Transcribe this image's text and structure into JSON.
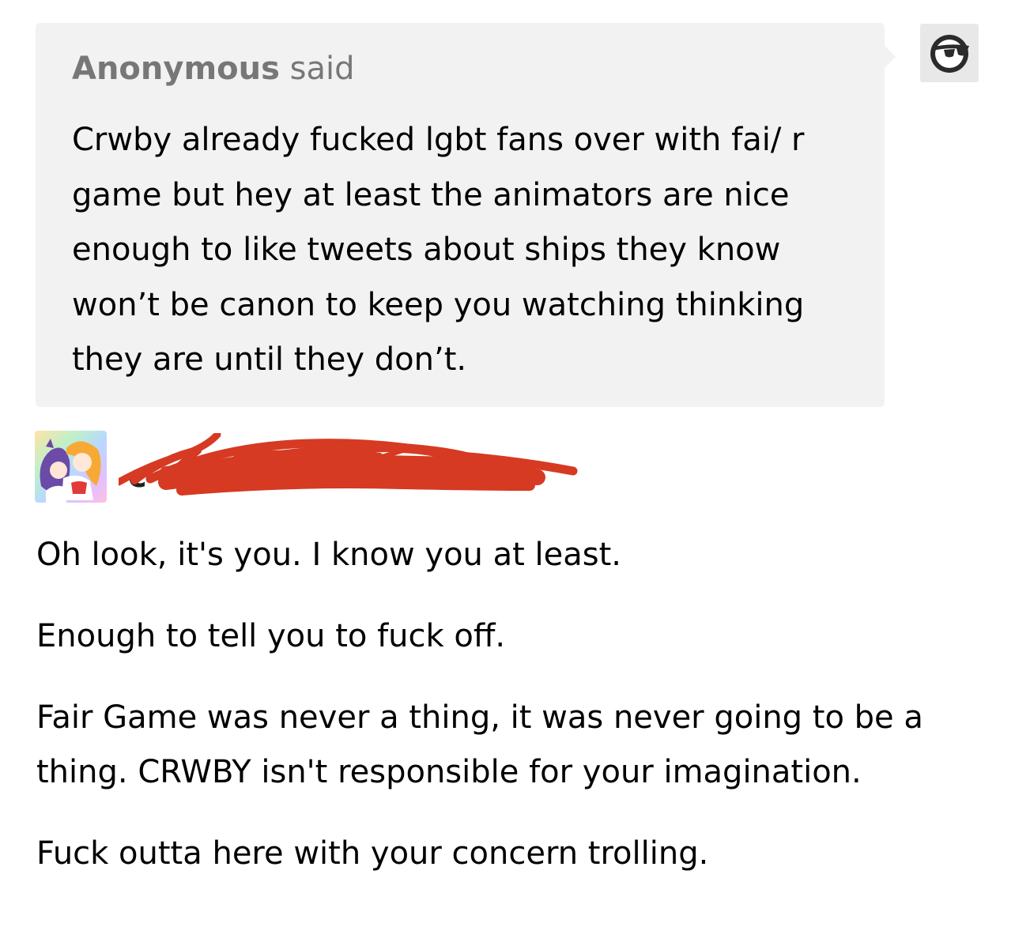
{
  "ask": {
    "asker_name": "Anonymous",
    "asker_suffix": "said",
    "question": "Crwby already fucked lgbt fans over with fai/ r game but hey at least the animators are nice enough to like tweets about ships they know won’t be canon to keep you watching thinking they are until they don’t."
  },
  "icons": {
    "anon_avatar": "sunglasses-ghost-icon",
    "user_avatar": "anime-couple-rainbow-avatar"
  },
  "responder": {
    "username_visible": "c",
    "redaction_color": "#d63a22"
  },
  "answer": {
    "paragraphs": [
      "Oh look, it's you. I know you at least.",
      "Enough to tell you to fuck off.",
      "Fair Game was never a thing, it was never going to be a thing. CRWBY isn't responsible for your imagination.",
      "Fuck outta here with your concern trolling."
    ]
  },
  "colors": {
    "ask_background": "#f2f2f2",
    "asker_text": "#777777",
    "body_text": "#000000"
  }
}
